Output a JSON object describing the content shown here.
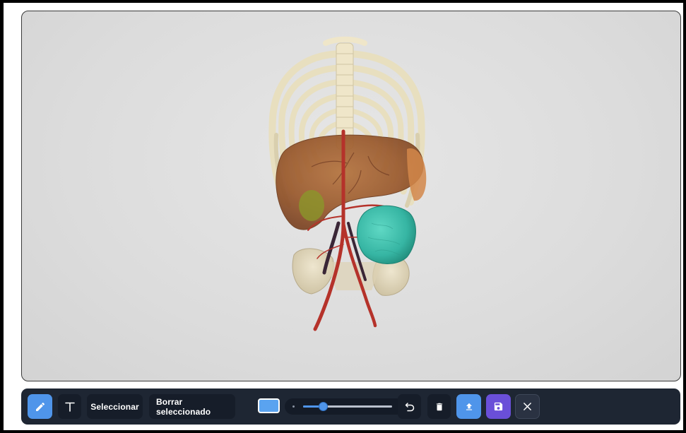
{
  "viewer": {
    "model_name": "3d-anatomy-model"
  },
  "toolbar": {
    "pen_icon": "pencil-icon",
    "text_icon": "text-tool-icon",
    "select_label": "Seleccionar",
    "delete_selected_label": "Borrar seleccionado",
    "color_value": "#5aa3f0",
    "brush_size_fraction": 0.22,
    "undo_icon": "undo-icon",
    "trash_icon": "trash-icon",
    "upload_icon": "upload-icon",
    "save_icon": "save-icon",
    "close_icon": "close-icon"
  },
  "colors": {
    "toolbar_bg": "#1e2633",
    "button_bg": "#161d29",
    "active_blue": "#4f95ea",
    "save_purple": "#6a4fd8"
  }
}
